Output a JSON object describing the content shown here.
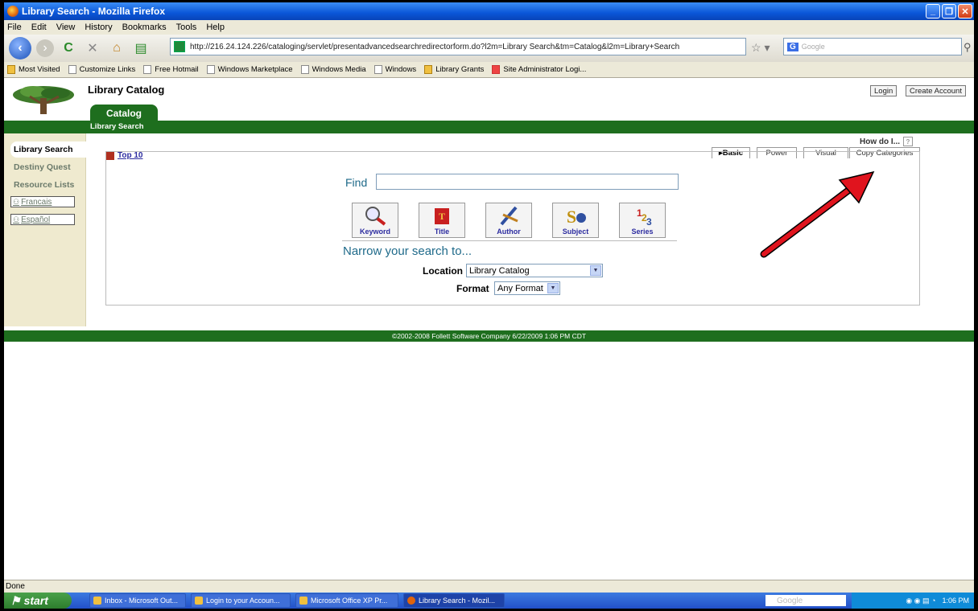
{
  "window": {
    "title": "Library Search - Mozilla Firefox"
  },
  "menu": [
    "File",
    "Edit",
    "View",
    "History",
    "Bookmarks",
    "Tools",
    "Help"
  ],
  "address": {
    "url": "http://216.24.124.226/cataloging/servlet/presentadvancedsearchredirectorform.do?l2m=Library Search&tm=Catalog&l2m=Library+Search",
    "search_placeholder": "Google"
  },
  "bookmarks": [
    "Most Visited",
    "Customize Links",
    "Free Hotmail",
    "Windows Marketplace",
    "Windows Media",
    "Windows",
    "Library Grants",
    "Site Administrator Logi..."
  ],
  "header": {
    "title": "Library Catalog",
    "login": "Login",
    "create_account": "Create Account",
    "tab": "Catalog",
    "crumb": "Library Search"
  },
  "sidebar": {
    "items": [
      "Library Search",
      "Destiny Quest",
      "Resource Lists"
    ],
    "languages": [
      "Francais",
      "Español"
    ]
  },
  "main": {
    "top10": "Top 10",
    "how_do_i": "How do I...",
    "help_glyph": "?",
    "tabs": [
      "▸Basic",
      "Power",
      "Visual",
      "Copy Categories"
    ],
    "find_label": "Find",
    "search_buttons": [
      "Keyword",
      "Title",
      "Author",
      "Subject",
      "Series"
    ],
    "narrow": "Narrow your search to...",
    "location_label": "Location",
    "location_value": "Library Catalog",
    "format_label": "Format",
    "format_value": "Any Format"
  },
  "footer": {
    "text": "©2002-2008 Follett Software Company    6/22/2009 1:06 PM CDT"
  },
  "status": {
    "text": "Done"
  },
  "taskbar": {
    "start": "start",
    "tasks": [
      "Inbox - Microsoft Out...",
      "Login to your Accoun...",
      "Microsoft Office XP Pr...",
      "Library Search - Mozil..."
    ],
    "search_text": "Google",
    "clock": "1:06 PM"
  },
  "colors": {
    "brand_green": "#1e6e1e",
    "link_blue": "#2c2ca0",
    "annotation_red": "#e0141e"
  }
}
